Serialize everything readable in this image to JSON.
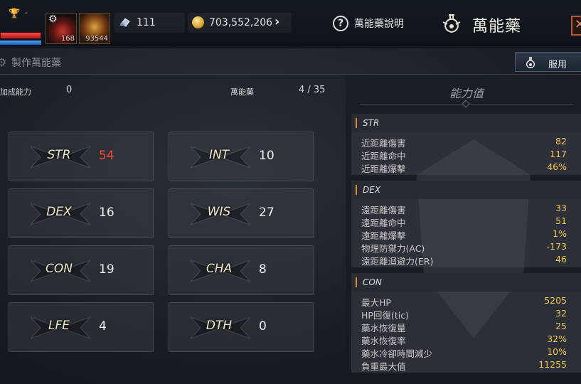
{
  "top_bar": {
    "rank_marker": "-",
    "slot1_count": "168",
    "slot2_count": "93544",
    "crystal_amount": "111",
    "gold_amount": "703,552,206",
    "help_label": "萬能藥說明",
    "title": "萬能藥"
  },
  "sub_bar": {
    "section_title": "製作萬能藥",
    "use_button_label": "服用"
  },
  "summary": {
    "bonus_label": "加成能力",
    "bonus_value": "0",
    "elixir_label": "萬能藥",
    "elixir_value": "4 / 35"
  },
  "stats": [
    {
      "name": "STR",
      "value": "54"
    },
    {
      "name": "INT",
      "value": "10"
    },
    {
      "name": "DEX",
      "value": "16"
    },
    {
      "name": "WIS",
      "value": "27"
    },
    {
      "name": "CON",
      "value": "19"
    },
    {
      "name": "CHA",
      "value": "8"
    },
    {
      "name": "LFE",
      "value": "4"
    },
    {
      "name": "DTH",
      "value": "0"
    }
  ],
  "ability_panel": {
    "title": "能力值",
    "groups": [
      {
        "name": "STR",
        "rows": [
          {
            "label": "近距離傷害",
            "value": "82"
          },
          {
            "label": "近距離命中",
            "value": "117"
          },
          {
            "label": "近距離爆擊",
            "value": "46%"
          }
        ]
      },
      {
        "name": "DEX",
        "rows": [
          {
            "label": "遠距離傷害",
            "value": "33"
          },
          {
            "label": "遠距離命中",
            "value": "51"
          },
          {
            "label": "遠距離爆擊",
            "value": "1%"
          },
          {
            "label": "物理防禦力(AC)",
            "value": "-173"
          },
          {
            "label": "遠距離迴避力(ER)",
            "value": "46"
          }
        ]
      },
      {
        "name": "CON",
        "rows": [
          {
            "label": "最大HP",
            "value": "5205"
          },
          {
            "label": "HP回復(tic)",
            "value": "32"
          },
          {
            "label": "藥水恢復量",
            "value": "25"
          },
          {
            "label": "藥水恢復率",
            "value": "32%"
          },
          {
            "label": "藥水冷卻時間減少",
            "value": "10%"
          },
          {
            "label": "負重最大值",
            "value": "11255"
          }
        ]
      }
    ]
  },
  "colors": {
    "accent_gold": "#f2c84a",
    "highlight_red": "#ff4a3a",
    "group_marker": "#e08a3a"
  }
}
